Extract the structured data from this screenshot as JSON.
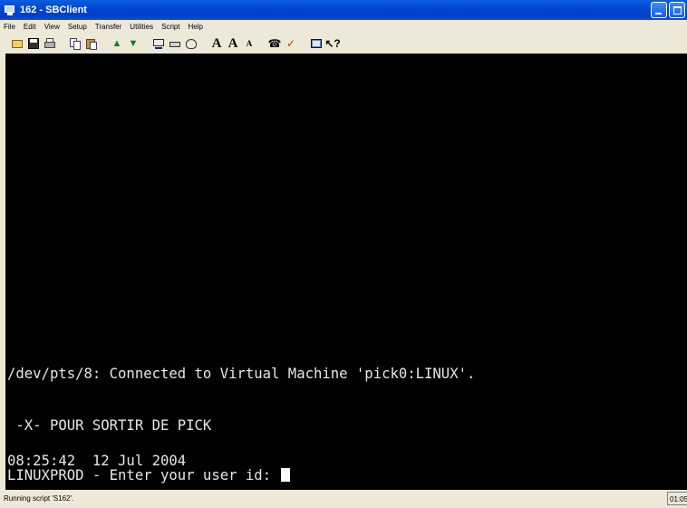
{
  "window": {
    "title": "162 - SBClient"
  },
  "menu": {
    "items": [
      "File",
      "Edit",
      "View",
      "Setup",
      "Transfer",
      "Utilities",
      "Script",
      "Help"
    ]
  },
  "toolbar": {
    "icons": [
      "open-folder-icon",
      "save-disk-icon",
      "print-icon",
      "copy-icon",
      "paste-icon",
      "upload-arrow-icon",
      "download-arrow-icon",
      "terminal-monitor-icon",
      "keyboard-icon",
      "hat-icon",
      "font-large-icon",
      "font-larger-icon",
      "font-small-icon",
      "phone-icon",
      "checkmark-icon",
      "screen-icon",
      "help-pointer-icon"
    ],
    "font_large": "A",
    "font_larger": "A",
    "font_small": "A"
  },
  "terminal": {
    "line_connected": "/dev/pts/8: Connected to Virtual Machine 'pick0:LINUX'.",
    "line_exit": " -X- POUR SORTIR DE PICK",
    "line_time": "08:25:42  12 Jul 2004",
    "line_prompt": "LINUXPROD - Enter your user id: "
  },
  "status": {
    "message": "Running script 'S162'.",
    "clock": "01:05"
  },
  "colors": {
    "titlebar": "#0046D5",
    "terminal_bg": "#000000",
    "terminal_fg": "#E6E6E6",
    "chrome": "#ECE9D8"
  }
}
